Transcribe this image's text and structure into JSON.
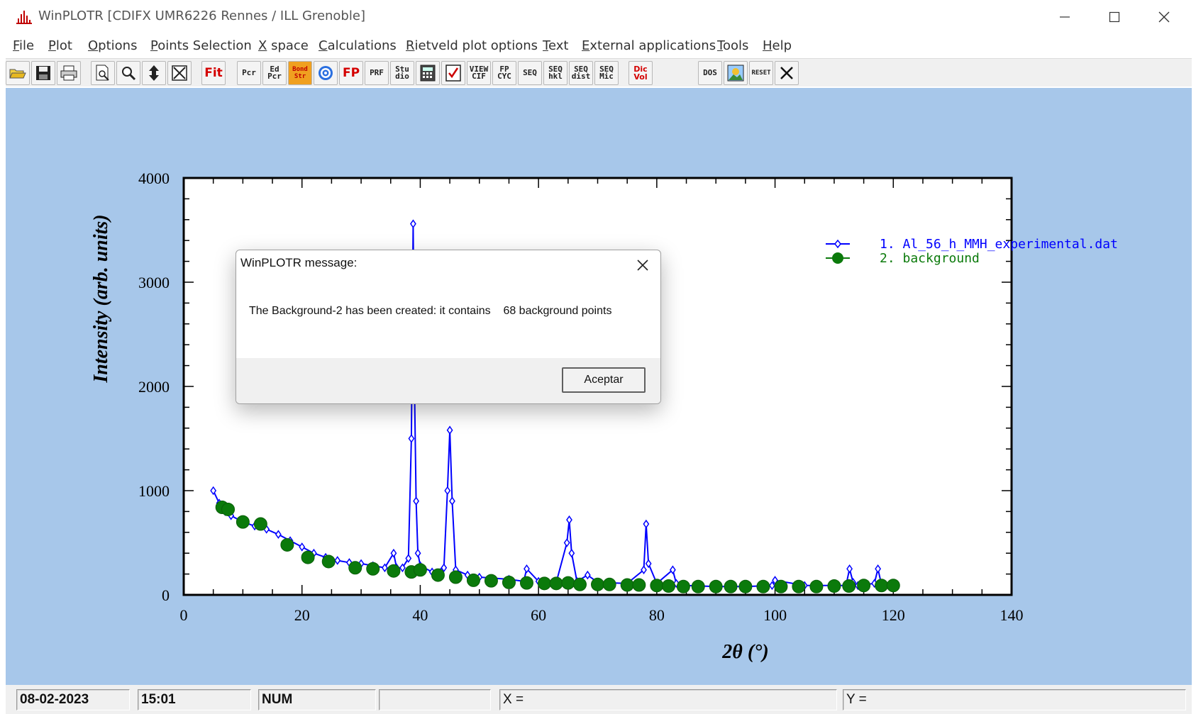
{
  "window": {
    "title": "WinPLOTR [CDIFX UMR6226 Rennes / ILL Grenoble]"
  },
  "menu": {
    "items": [
      {
        "label": "File",
        "u": "F",
        "rest": "ile"
      },
      {
        "label": "Plot",
        "u": "P",
        "rest": "lot"
      },
      {
        "label": "Options",
        "u": "O",
        "rest": "ptions"
      },
      {
        "label": "Points Selection",
        "u": "P",
        "rest": "oints Selection"
      },
      {
        "label": "X space",
        "u": "X",
        "rest": " space"
      },
      {
        "label": "Calculations",
        "u": "C",
        "rest": "alculations"
      },
      {
        "label": "Rietveld plot options",
        "u": "R",
        "rest": "ietveld plot options"
      },
      {
        "label": "Text",
        "u": "T",
        "rest": "ext"
      },
      {
        "label": "External applications",
        "u": "E",
        "rest": "xternal applications"
      },
      {
        "label": "Tools",
        "u": "T",
        "rest": "ools"
      },
      {
        "label": "Help",
        "u": "H",
        "rest": "elp"
      }
    ]
  },
  "toolbar": {
    "buttons": [
      {
        "name": "open-folder-icon",
        "text": ""
      },
      {
        "name": "save-icon",
        "text": ""
      },
      {
        "name": "print-icon",
        "text": ""
      },
      {
        "name": "print-preview-icon",
        "text": ""
      },
      {
        "name": "zoom-icon",
        "text": ""
      },
      {
        "name": "move-vertical-icon",
        "text": ""
      },
      {
        "name": "fit-window-icon",
        "text": ""
      },
      {
        "name": "fit-icon",
        "text": "Fit"
      },
      {
        "name": "pcr-icon",
        "text": "Pcr"
      },
      {
        "name": "edit-pcr-icon",
        "text": "Ed\nPcr"
      },
      {
        "name": "bond-str-icon",
        "text": "Bond\nStr"
      },
      {
        "name": "target-icon",
        "text": ""
      },
      {
        "name": "fp-icon",
        "text": "FP"
      },
      {
        "name": "prf-icon",
        "text": "PRF"
      },
      {
        "name": "studio-icon",
        "text": "Stu\ndio"
      },
      {
        "name": "calculator-icon",
        "text": ""
      },
      {
        "name": "checklist-icon",
        "text": ""
      },
      {
        "name": "view-cif-icon",
        "text": "VIEW\nCIF"
      },
      {
        "name": "fp-cyc-icon",
        "text": "FP\nCYC"
      },
      {
        "name": "seq-icon",
        "text": "SEQ"
      },
      {
        "name": "seq-hkl-icon",
        "text": "SEQ\nhkl"
      },
      {
        "name": "seq-dist-icon",
        "text": "SEQ\ndist"
      },
      {
        "name": "seq-mic-icon",
        "text": "SEQ\nMic"
      },
      {
        "name": "dicvol-icon",
        "text": "Dic\nVol"
      },
      {
        "name": "dos-icon",
        "text": "DOS"
      },
      {
        "name": "image-icon",
        "text": ""
      },
      {
        "name": "reset-icon",
        "text": "RESET"
      },
      {
        "name": "close-icon",
        "text": ""
      }
    ]
  },
  "chart_data": {
    "type": "scatter",
    "xlabel": "2θ (°)",
    "ylabel": "Intensity (arb. units)",
    "xlim": [
      0,
      140
    ],
    "ylim": [
      0,
      4000
    ],
    "x_ticks": [
      "0",
      "20",
      "40",
      "60",
      "80",
      "100",
      "120",
      "140"
    ],
    "y_ticks": [
      "0",
      "1000",
      "2000",
      "3000",
      "4000"
    ],
    "legend_position": "top-right",
    "series": [
      {
        "name": "1. Al_56_h_MMH_experimental.dat",
        "color": "#0000ff",
        "marker": "open-diamond-line",
        "x": [
          5,
          6,
          7,
          8,
          10,
          12,
          14,
          16,
          18,
          20,
          22,
          24,
          26,
          28,
          30,
          32,
          34,
          35.5,
          36,
          37,
          38,
          38.5,
          38.8,
          39,
          39.3,
          39.6,
          40,
          42,
          44,
          44.6,
          45,
          45.4,
          46,
          48,
          50,
          55,
          57.5,
          58,
          60,
          63,
          64.8,
          65.2,
          65.6,
          66.5,
          68.3,
          70,
          75,
          77.8,
          78.2,
          78.6,
          80,
          82.7,
          83.3,
          85,
          90,
          95,
          99.5,
          100,
          105,
          110,
          112,
          112.6,
          113.2,
          114,
          116.8,
          117.4,
          118,
          120
        ],
        "y": [
          1000,
          880,
          800,
          760,
          700,
          660,
          630,
          580,
          520,
          460,
          400,
          360,
          330,
          310,
          300,
          280,
          260,
          400,
          260,
          260,
          350,
          1500,
          3560,
          2100,
          900,
          400,
          280,
          220,
          260,
          1000,
          1580,
          900,
          240,
          190,
          170,
          150,
          130,
          250,
          130,
          120,
          500,
          720,
          400,
          130,
          190,
          120,
          110,
          240,
          680,
          300,
          110,
          240,
          110,
          90,
          80,
          80,
          90,
          140,
          90,
          90,
          90,
          250,
          120,
          90,
          110,
          250,
          100,
          80
        ]
      },
      {
        "name": "2. background",
        "color": "#0b7a0b",
        "marker": "filled-circle",
        "x": [
          6.5,
          7.5,
          10,
          13,
          17.5,
          21,
          24.5,
          29,
          32,
          35.5,
          38.5,
          40,
          43,
          46,
          49,
          52,
          55,
          58,
          61,
          63,
          65,
          67,
          70,
          72,
          75,
          77,
          80,
          82,
          84.5,
          87,
          90,
          92.5,
          95,
          98,
          101,
          104,
          107,
          110,
          112.5,
          115,
          118,
          120
        ],
        "y": [
          840,
          820,
          700,
          680,
          480,
          360,
          320,
          260,
          250,
          230,
          220,
          240,
          190,
          170,
          140,
          135,
          120,
          115,
          110,
          110,
          115,
          100,
          100,
          100,
          95,
          95,
          90,
          85,
          80,
          80,
          80,
          80,
          80,
          80,
          80,
          80,
          80,
          85,
          85,
          90,
          90,
          90
        ]
      }
    ]
  },
  "dialog": {
    "title": "WinPLOTR message:",
    "message": "The Background-2 has been created: it contains    68 background points",
    "ok_label": "Aceptar"
  },
  "statusbar": {
    "date": "08-02-2023",
    "time": "15:01",
    "num": "NUM",
    "empty": "",
    "x_label": "X =",
    "y_label": "Y ="
  }
}
